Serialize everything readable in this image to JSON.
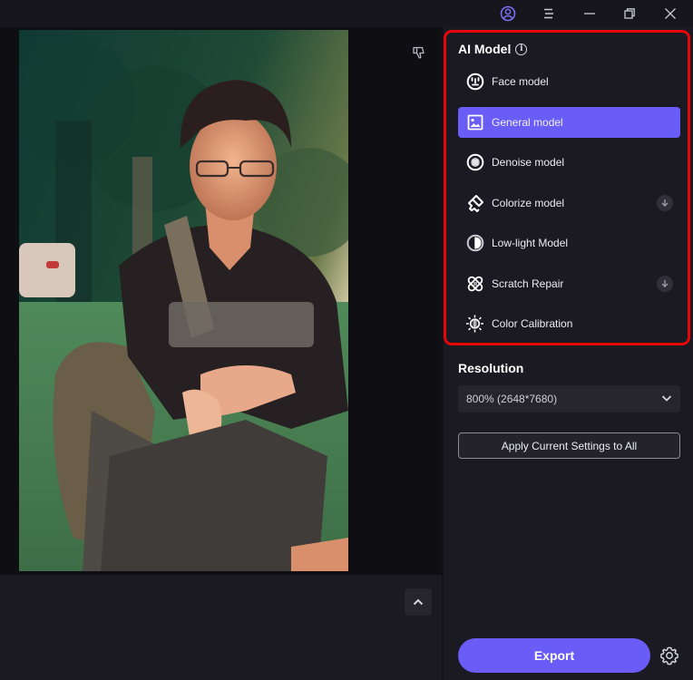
{
  "titlebar": {
    "icons": [
      "account-icon",
      "menu-icon",
      "minimize-icon",
      "restore-icon",
      "close-icon"
    ]
  },
  "canvas": {
    "photo_description": "Young man with glasses in black t-shirt crouching on grass in front of trees",
    "dislike_icon": "thumbs-down-icon",
    "collapse_icon": "chevron-up-icon"
  },
  "panel": {
    "ai_model": {
      "title": "AI Model",
      "info_glyph": "i",
      "items": [
        {
          "label": "Face model",
          "icon": "face-icon",
          "active": false,
          "download": false
        },
        {
          "label": "General model",
          "icon": "image-icon",
          "active": true,
          "download": false
        },
        {
          "label": "Denoise model",
          "icon": "denoise-icon",
          "active": false,
          "download": false
        },
        {
          "label": "Colorize model",
          "icon": "paint-bucket-icon",
          "active": false,
          "download": true
        },
        {
          "label": "Low-light Model",
          "icon": "half-circle-icon",
          "active": false,
          "download": false
        },
        {
          "label": "Scratch Repair",
          "icon": "bandage-icon",
          "active": false,
          "download": true
        },
        {
          "label": "Color Calibration",
          "icon": "sun-icon",
          "active": false,
          "download": false
        }
      ]
    },
    "resolution": {
      "title": "Resolution",
      "selected": "800% (2648*7680)"
    },
    "apply_label": "Apply Current Settings to All",
    "export_label": "Export"
  },
  "colors": {
    "accent": "#6a5cf6",
    "highlight_border": "#e8060b",
    "panel_bg": "#1b1a23",
    "app_bg": "#17161d"
  }
}
